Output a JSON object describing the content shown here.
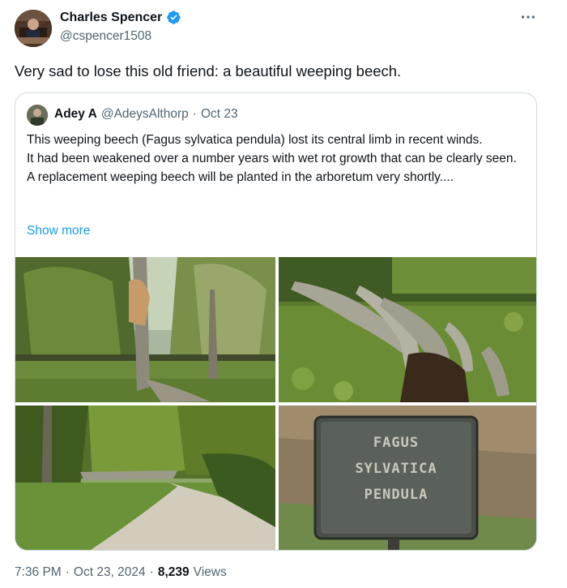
{
  "author": {
    "name": "Charles Spencer",
    "handle": "@cspencer1508",
    "verified": true,
    "verified_color": "#1d9bf0"
  },
  "tweet": {
    "text": "Very sad to lose this old friend: a beautiful weeping beech."
  },
  "quote": {
    "name": "Adey A",
    "handle": "@AdeysAlthorp",
    "separator": "·",
    "date": "Oct 23",
    "text_lines": [
      "This weeping beech (Fagus sylvatica pendula) lost its central limb in recent winds.",
      "It had been weakened over a number years with wet rot growth that can be clearly seen. A replacement weeping beech will be planted in the arboretum very shortly...."
    ],
    "show_more": "Show more"
  },
  "sign": {
    "line1": "FAGUS",
    "line2": "SYLVATICA",
    "line3": "PENDULA"
  },
  "meta": {
    "time": "7:36 PM",
    "separator": "·",
    "date": "Oct 23, 2024",
    "separator2": "·",
    "views_count": "8,239",
    "views_label": "Views"
  },
  "colors": {
    "link": "#1d9bf0",
    "secondary_text": "#536471",
    "border": "#cfd9de"
  },
  "icons": {
    "verified": "verified-badge-icon",
    "more": "more-options-icon"
  }
}
